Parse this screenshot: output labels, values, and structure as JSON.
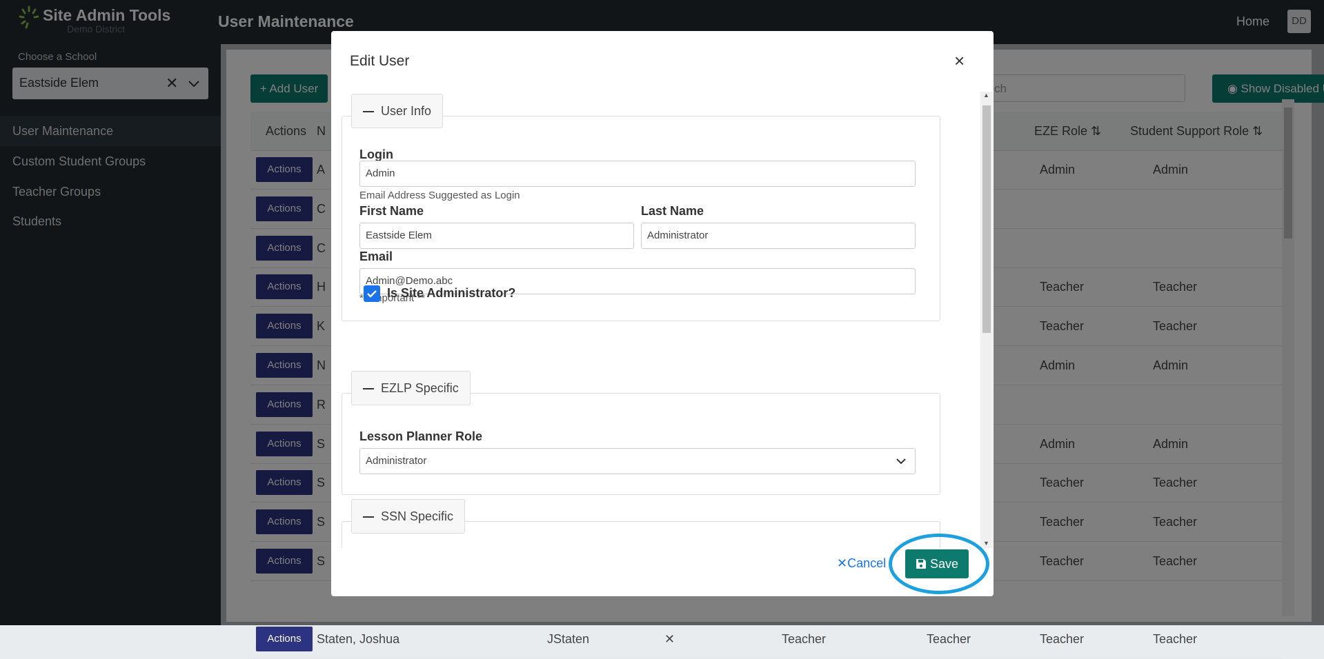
{
  "app": {
    "title": "Site Admin Tools",
    "subtitle": "Demo District",
    "page_title": "User Maintenance",
    "home": "Home",
    "avatar": "DD"
  },
  "sidebar": {
    "school_label": "Choose a School",
    "school_value": "Eastside Elem",
    "items": [
      {
        "label": "User Maintenance",
        "active": true
      },
      {
        "label": "Custom Student Groups"
      },
      {
        "label": "Teacher Groups"
      },
      {
        "label": "Students"
      }
    ]
  },
  "toolbar": {
    "add_user": "Add User",
    "search_placeholder": "ch",
    "show_disabled": "Show Disabled Users"
  },
  "table": {
    "headers": {
      "actions": "Actions",
      "name": "N",
      "eze_role": "EZE Role",
      "ss_role": "Student Support Role"
    },
    "action_label": "Actions",
    "rows": [
      {
        "initial": "A",
        "eze": "Admin",
        "ss": "Admin"
      },
      {
        "initial": "C",
        "eze": "",
        "ss": ""
      },
      {
        "initial": "C",
        "eze": "",
        "ss": ""
      },
      {
        "initial": "H",
        "eze": "Teacher",
        "ss": "Teacher"
      },
      {
        "initial": "K",
        "eze": "Teacher",
        "ss": "Teacher"
      },
      {
        "initial": "N",
        "eze": "Admin",
        "ss": "Admin"
      },
      {
        "initial": "R",
        "eze": "",
        "ss": ""
      },
      {
        "initial": "S",
        "eze": "Admin",
        "ss": "Admin"
      },
      {
        "initial": "S",
        "eze": "Teacher",
        "ss": "Teacher"
      },
      {
        "initial": "S",
        "eze": "Teacher",
        "ss": "Teacher"
      },
      {
        "initial": "S",
        "eze": "Teacher",
        "ss": "Teacher"
      }
    ],
    "last_row": {
      "name": "Staten, Joshua",
      "login": "JStaten",
      "role1": "Teacher",
      "role2": "Teacher",
      "eze": "Teacher",
      "ss": "Teacher"
    }
  },
  "modal": {
    "title": "Edit User",
    "user_info": {
      "legend": "User Info",
      "login_label": "Login",
      "login_value": "Admin",
      "login_hint": "Email Address Suggested as Login",
      "first_name_label": "First Name",
      "first_name_value": "Eastside Elem",
      "last_name_label": "Last Name",
      "last_name_value": "Administrator",
      "email_label": "Email",
      "email_value": "Admin@Demo.abc",
      "email_hint": "** Important **",
      "site_admin_label": "Is Site Administrator?",
      "site_admin_checked": true
    },
    "ezlp": {
      "legend": "EZLP Specific",
      "role_label": "Lesson Planner Role",
      "role_value": "Administrator"
    },
    "ssn": {
      "legend": "SSN Specific"
    },
    "cancel": "Cancel",
    "save": "Save"
  },
  "colors": {
    "accent": "#0d7a6e",
    "actions_btn": "#2c3380",
    "highlight": "#1ea0de"
  }
}
